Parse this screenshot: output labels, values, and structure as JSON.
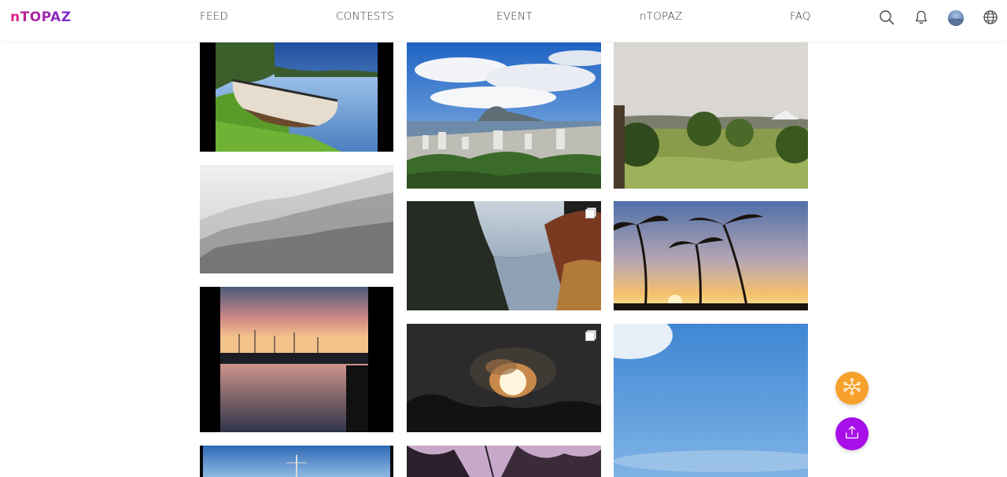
{
  "brand": {
    "logo_n": "n",
    "logo_rest": "TOPAZ"
  },
  "nav": {
    "feed": "FEED",
    "contests": "CONTESTS",
    "event": "EVENT",
    "ntopaz": "nTOPAZ",
    "faq": "FAQ"
  },
  "header_icons": [
    "search-icon",
    "bell-icon",
    "avatar",
    "globe-icon"
  ],
  "colors": {
    "brand_pink": "#e0228a",
    "brand_purple": "#7a2fd6",
    "fab_orange": "#f7a12a",
    "fab_purple": "#a70ee8"
  },
  "gallery": {
    "columns": 3,
    "photos": [
      {
        "subject": "boat-on-lake"
      },
      {
        "subject": "rio-de-janeiro-city-view"
      },
      {
        "subject": "garden-park-haze"
      },
      {
        "subject": "snowy-foggy-forest"
      },
      {
        "subject": "river-reflection-autumn"
      },
      {
        "subject": "palm-tree-sunset"
      },
      {
        "subject": "harbor-sunset-reflection"
      },
      {
        "subject": "sun-behind-clouds"
      },
      {
        "subject": "blue-sky"
      },
      {
        "subject": "sailboat-mast-blue"
      },
      {
        "subject": "tree-silhouette-purple"
      }
    ]
  },
  "fabs": [
    "network-icon",
    "upload-icon"
  ]
}
